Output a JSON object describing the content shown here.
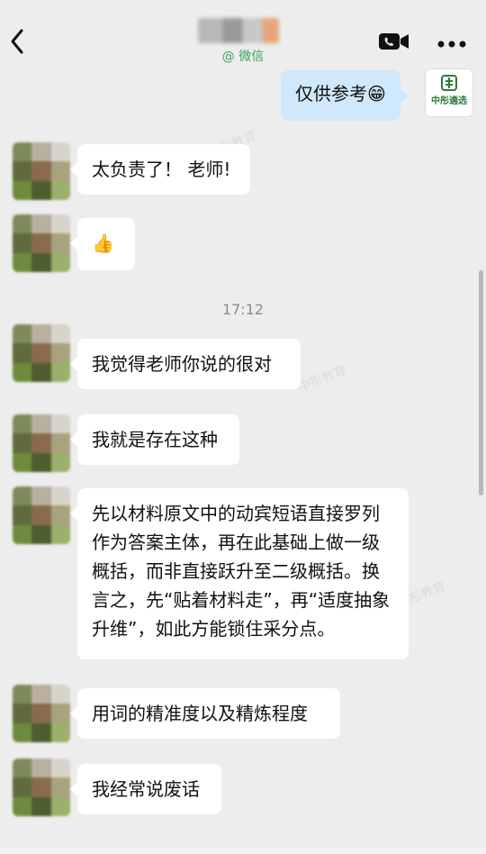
{
  "header": {
    "title_blurred": true,
    "subtitle": "@ 微信",
    "back_icon": "chevron-left-icon",
    "call_icon": "video-call-icon",
    "more_icon": "more-dots-icon"
  },
  "self": {
    "message": "仅供参考😁",
    "avatar_text": "中彤遴选"
  },
  "timestamp": "17:12",
  "messages": [
    {
      "text": "太负责了！ 老师!"
    },
    {
      "text": "👍"
    },
    {
      "text": "我觉得老师你说的很对"
    },
    {
      "text": "我就是存在这种"
    },
    {
      "text": "先以材料原文中的动宾短语直接罗列作为答案主体，再在此基础上做一级概括，而非直接跃升至二级概括。换言之，先“贴着材料走”，再“适度抽象升维”，如此方能锁住采分点。"
    },
    {
      "text": "用词的精准度以及精炼程度"
    },
    {
      "text": "我经常说废话"
    }
  ],
  "colors": {
    "background": "#ededed",
    "self_bubble": "#cfe8fb",
    "other_bubble": "#ffffff",
    "subtitle_green": "#3aa05a"
  },
  "watermark": "中彤教育"
}
